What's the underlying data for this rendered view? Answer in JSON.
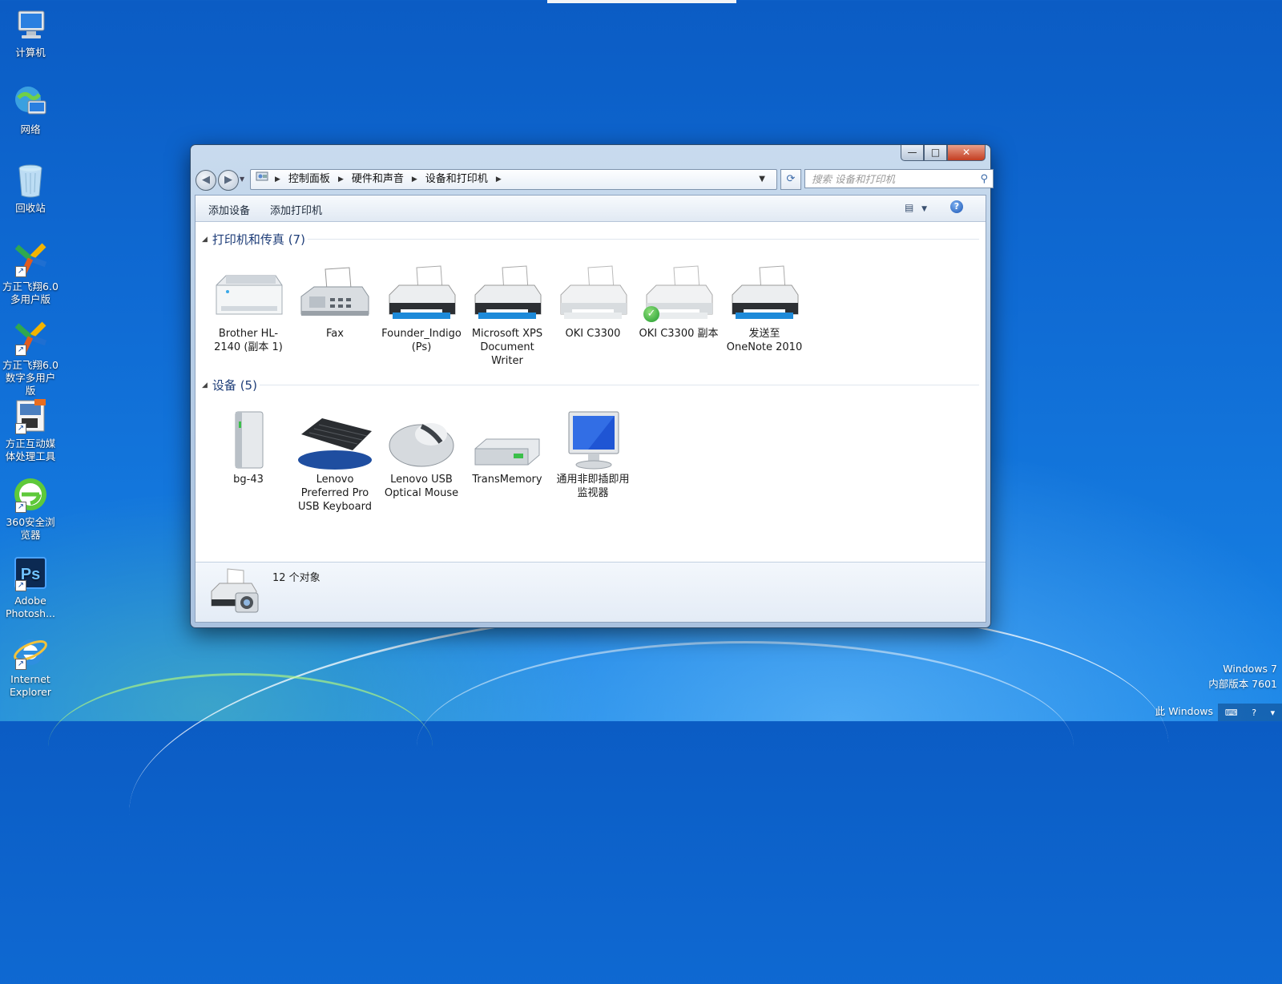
{
  "desktop": {
    "icons": [
      {
        "label": "计算机",
        "icon": "computer-icon"
      },
      {
        "label": "网络",
        "icon": "network-icon"
      },
      {
        "label": "回收站",
        "icon": "recycle-bin-icon"
      },
      {
        "label": "方正飞翔6.0多用户版",
        "icon": "founder-feixiang-icon"
      },
      {
        "label": "方正飞翔6.0数字多用户版",
        "icon": "founder-feixiang-digital-icon"
      },
      {
        "label": "方正互动媒体处理工具",
        "icon": "founder-media-tool-icon"
      },
      {
        "label": "360安全浏览器",
        "icon": "browser-360-icon"
      },
      {
        "label": "Adobe Photosh...",
        "icon": "photoshop-icon"
      },
      {
        "label": "Internet Explorer",
        "icon": "internet-explorer-icon"
      }
    ],
    "watermark_line1": "Windows 7",
    "watermark_line2": "内部版本 7601",
    "watermark_line3": "此 Windows"
  },
  "window": {
    "caption": {
      "minimize": "—",
      "maximize": "□",
      "close": "✕"
    },
    "address": {
      "crumbs": [
        "控制面板",
        "硬件和声音",
        "设备和打印机"
      ]
    },
    "search_placeholder": "搜索 设备和打印机",
    "commands": {
      "add_device": "添加设备",
      "add_printer": "添加打印机"
    },
    "groups": [
      {
        "title": "打印机和传真 (7)",
        "items": [
          {
            "label": "Brother HL-2140 (副本 1)",
            "icon": "laser-printer-icon",
            "default": false
          },
          {
            "label": "Fax",
            "icon": "fax-icon",
            "default": false
          },
          {
            "label": "Founder_Indigo (Ps)",
            "icon": "printer-icon",
            "default": false
          },
          {
            "label": "Microsoft XPS Document Writer",
            "icon": "printer-icon",
            "default": false
          },
          {
            "label": "OKI C3300",
            "icon": "printer-icon",
            "default": false
          },
          {
            "label": "OKI C3300 副本",
            "icon": "printer-icon",
            "default": true
          },
          {
            "label": "发送至 OneNote 2010",
            "icon": "printer-icon",
            "default": false
          }
        ]
      },
      {
        "title": "设备 (5)",
        "items": [
          {
            "label": "bg-43",
            "icon": "computer-tower-icon"
          },
          {
            "label": "Lenovo Preferred Pro USB Keyboard",
            "icon": "keyboard-icon"
          },
          {
            "label": "Lenovo USB Optical Mouse",
            "icon": "mouse-icon"
          },
          {
            "label": "TransMemory",
            "icon": "usb-drive-icon"
          },
          {
            "label": "通用非即插即用监视器",
            "icon": "monitor-icon"
          }
        ]
      }
    ],
    "status": "12 个对象"
  }
}
